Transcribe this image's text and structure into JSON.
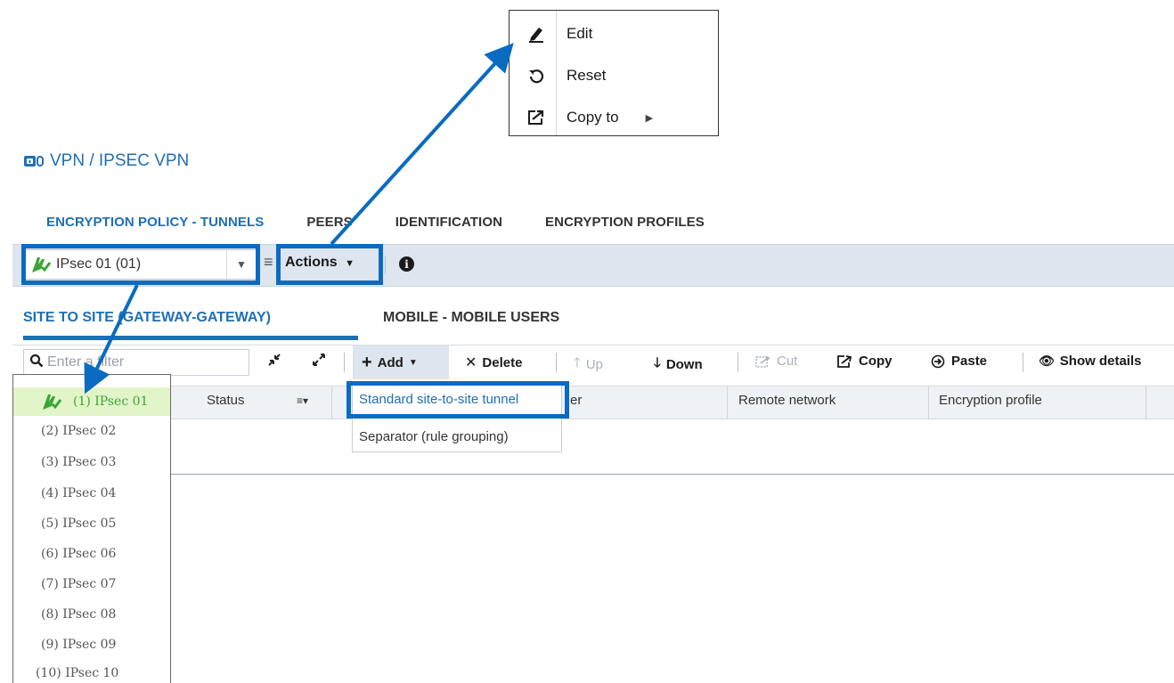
{
  "page_title": "VPN / IPSEC VPN",
  "top_tabs": [
    {
      "label": "ENCRYPTION POLICY - TUNNELS",
      "active": true
    },
    {
      "label": "PEERS",
      "active": false
    },
    {
      "label": "IDENTIFICATION",
      "active": false
    },
    {
      "label": "ENCRYPTION PROFILES",
      "active": false
    }
  ],
  "policy_selector": {
    "value": "IPsec 01 (01)"
  },
  "actions_label": "Actions",
  "sub_tabs": [
    {
      "label": "SITE TO SITE (GATEWAY-GATEWAY)",
      "active": true
    },
    {
      "label": "MOBILE - MOBILE USERS",
      "active": false
    }
  ],
  "filter_placeholder": "Enter a filter",
  "grid_toolbar": {
    "add": "Add",
    "delete": "Delete",
    "up": "Up",
    "down": "Down",
    "cut": "Cut",
    "copy": "Copy",
    "paste": "Paste",
    "show_details": "Show details"
  },
  "columns": [
    "Status",
    "er",
    "Remote network",
    "Encryption profile"
  ],
  "add_menu": [
    "Standard site-to-site tunnel",
    "Separator (rule grouping)"
  ],
  "actions_menu": [
    {
      "label": "Edit",
      "icon": "pencil-icon"
    },
    {
      "label": "Reset",
      "icon": "reset-icon"
    },
    {
      "label": "Copy to",
      "icon": "copy-to-icon",
      "submenu": true
    }
  ],
  "policy_list": [
    "(1) IPsec 01",
    "(2) IPsec 02",
    "(3) IPsec 03",
    "(4) IPsec 04",
    "(5) IPsec 05",
    "(6) IPsec 06",
    "(7) IPsec 07",
    "(8) IPsec 08",
    "(9) IPsec 09",
    "(10) IPsec 10"
  ],
  "colors": {
    "accent_blue": "#1f6fb5",
    "highlight_blue": "#0b6bc1",
    "toolbar_bg": "#dde5ef",
    "selected_row_bg": "#e2f5c8",
    "policy_icon_green": "#3aa535"
  }
}
